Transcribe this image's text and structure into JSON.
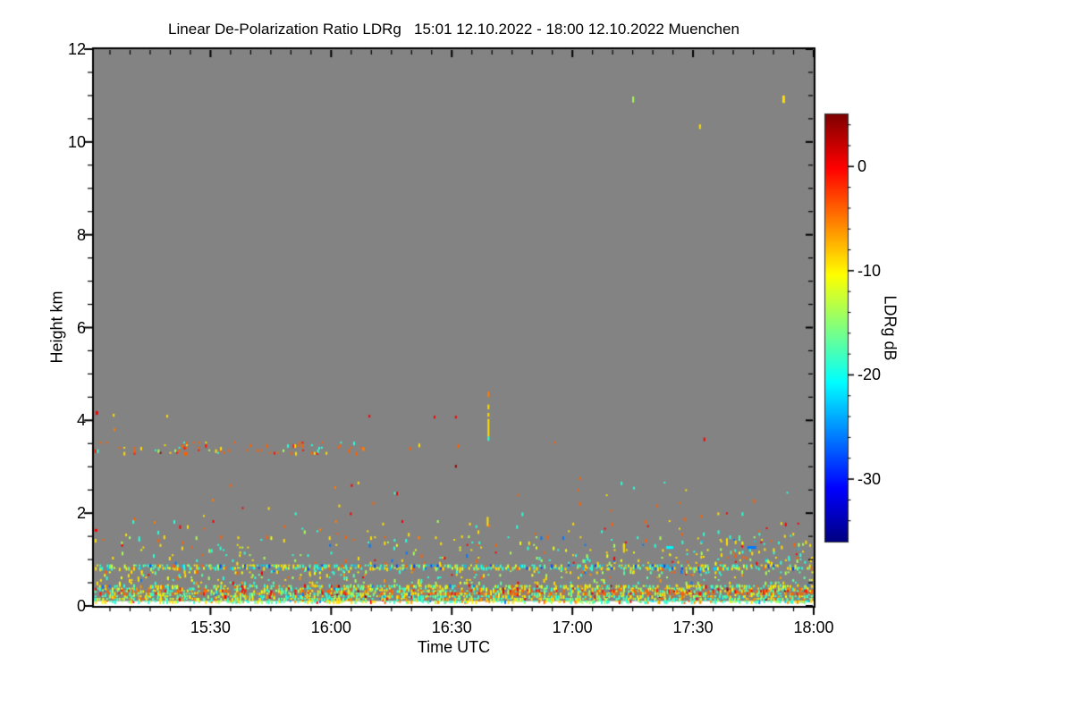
{
  "chart_data": {
    "type": "heatmap",
    "title": "Linear De-Polarization Ratio LDRg   15:01 12.10.2022 - 18:00 12.10.2022 Muenchen",
    "xlabel": "Time UTC",
    "ylabel": "Height km",
    "x_axis": {
      "start_label": "15:01",
      "end_label": "18:00",
      "duration_min": 179,
      "major_tick_minutes": [
        29,
        59,
        89,
        119,
        149,
        179
      ],
      "major_tick_labels": [
        "15:30",
        "16:00",
        "16:30",
        "17:00",
        "17:30",
        "18:00"
      ],
      "minor_tick_every_min": 5,
      "first_minor_min": 4
    },
    "y_axis": {
      "min": 0,
      "max": 12,
      "major_ticks": [
        0,
        2,
        4,
        6,
        8,
        10,
        12
      ],
      "minor_step": 0.5
    },
    "colorbar": {
      "label": "LDRg dB",
      "vmax": 5,
      "vmin": -36,
      "major_ticks": [
        0,
        -10,
        -20,
        -30
      ],
      "minor_step": 2,
      "colormap": "jet"
    },
    "colors": {
      "masked": "#838383",
      "below_ground": "#ffffff",
      "frame": "#000000",
      "text": "#000000"
    },
    "surface_top_km": 0.105,
    "noise_bands": [
      {
        "h": [
          0.1,
          0.45
        ],
        "density": 0.6,
        "palette": [
          [
            -19,
            0.2
          ],
          [
            -17,
            0.14
          ],
          [
            -14,
            0.12
          ],
          [
            -11,
            0.1
          ],
          [
            -9,
            0.22
          ],
          [
            -6,
            0.08
          ],
          [
            -4,
            0.07
          ],
          [
            0,
            0.04
          ],
          [
            -26,
            0.02
          ],
          [
            4,
            0.01
          ]
        ]
      },
      {
        "h": [
          0.1,
          0.22
        ],
        "density": 0.35,
        "palette": [
          [
            -19,
            0.25
          ],
          [
            -17,
            0.2
          ],
          [
            -14,
            0.15
          ],
          [
            -9,
            0.25
          ],
          [
            -6,
            0.1
          ],
          [
            -23,
            0.05
          ]
        ]
      },
      {
        "h": [
          0.28,
          0.38
        ],
        "density": 0.35,
        "palette": [
          [
            -4,
            0.45
          ],
          [
            -1,
            0.25
          ],
          [
            -9,
            0.18
          ],
          [
            -14,
            0.12
          ]
        ]
      },
      {
        "h": [
          0.45,
          0.75
        ],
        "density": 0.13,
        "palette": [
          [
            -19,
            0.2
          ],
          [
            -17,
            0.14
          ],
          [
            -14,
            0.12
          ],
          [
            -11,
            0.1
          ],
          [
            -9,
            0.22
          ],
          [
            -6,
            0.08
          ],
          [
            -4,
            0.07
          ],
          [
            0,
            0.05
          ],
          [
            -26,
            0.02
          ]
        ]
      },
      {
        "h": [
          0.75,
          0.82
        ],
        "density": 0.09,
        "palette": [
          [
            -19,
            0.25
          ],
          [
            -9,
            0.3
          ],
          [
            -14,
            0.2
          ],
          [
            -4,
            0.15
          ],
          [
            -26,
            0.1
          ]
        ]
      },
      {
        "h": [
          0.82,
          0.93
        ],
        "density": 0.62,
        "palette": [
          [
            -19,
            0.28
          ],
          [
            -17,
            0.12
          ],
          [
            -9,
            0.25
          ],
          [
            -12,
            0.15
          ],
          [
            -23,
            0.08
          ],
          [
            -4,
            0.06
          ],
          [
            -28,
            0.06
          ]
        ]
      },
      {
        "h": [
          0.93,
          1.5
        ],
        "density": 0.055,
        "palette": [
          [
            -19,
            0.22
          ],
          [
            -9,
            0.28
          ],
          [
            -14,
            0.14
          ],
          [
            -4,
            0.14
          ],
          [
            -11,
            0.1
          ],
          [
            0,
            0.06
          ],
          [
            -26,
            0.06
          ]
        ]
      },
      {
        "h": [
          0.95,
          1.4
        ],
        "t": [
          143,
          179
        ],
        "density": 0.08,
        "palette": [
          [
            -19,
            0.3
          ],
          [
            -9,
            0.3
          ],
          [
            -14,
            0.15
          ],
          [
            -4,
            0.1
          ],
          [
            -23,
            0.1
          ],
          [
            0,
            0.05
          ]
        ]
      },
      {
        "h": [
          1.4,
          1.8
        ],
        "t": [
          150,
          179
        ],
        "density": 0.025,
        "palette": [
          [
            -9,
            0.35
          ],
          [
            -4,
            0.25
          ],
          [
            -19,
            0.2
          ],
          [
            -14,
            0.1
          ],
          [
            0,
            0.1
          ]
        ]
      },
      {
        "h": [
          1.5,
          2.0
        ],
        "density": 0.02,
        "palette": [
          [
            -9,
            0.35
          ],
          [
            -4,
            0.25
          ],
          [
            -19,
            0.2
          ],
          [
            -14,
            0.1
          ],
          [
            0,
            0.1
          ]
        ]
      },
      {
        "h": [
          2.0,
          2.7
        ],
        "density": 0.006,
        "palette": [
          [
            -9,
            0.35
          ],
          [
            -4,
            0.3
          ],
          [
            -19,
            0.2
          ],
          [
            0,
            0.15
          ]
        ]
      },
      {
        "h": [
          2.7,
          3.25
        ],
        "density": 0.0015,
        "palette": [
          [
            -4,
            0.5
          ],
          [
            -9,
            0.3
          ],
          [
            0,
            0.2
          ]
        ]
      },
      {
        "h": [
          3.3,
          3.56
        ],
        "t": [
          0,
          68
        ],
        "density": 0.13,
        "palette": [
          [
            -4,
            0.5
          ],
          [
            -1,
            0.12
          ],
          [
            -9,
            0.14
          ],
          [
            4,
            0.04
          ],
          [
            -14,
            0.1
          ],
          [
            -19,
            0.1
          ]
        ]
      },
      {
        "h": [
          3.3,
          3.56
        ],
        "t": [
          68,
          125
        ],
        "density": 0.012,
        "palette": [
          [
            -4,
            0.55
          ],
          [
            -1,
            0.15
          ],
          [
            -9,
            0.2
          ],
          [
            -19,
            0.1
          ]
        ]
      }
    ],
    "segments": [
      [
        97.9,
        4.62,
        4.5,
        -5,
        2
      ],
      [
        97.9,
        4.34,
        4.24,
        -9,
        2
      ],
      [
        97.9,
        4.16,
        4.08,
        -9,
        2
      ],
      [
        97.9,
        4.03,
        3.65,
        -9,
        2
      ],
      [
        97.9,
        3.65,
        3.56,
        -19,
        2
      ],
      [
        97.7,
        1.92,
        1.72,
        -9,
        2
      ],
      [
        98.1,
        1.76,
        1.7,
        -5,
        2
      ],
      [
        133.9,
        10.98,
        10.85,
        -14,
        2
      ],
      [
        171.2,
        11.0,
        10.84,
        -9,
        3
      ],
      [
        150.5,
        10.38,
        10.28,
        -9,
        2
      ],
      [
        68.3,
        4.12,
        4.06,
        0,
        2
      ],
      [
        84.5,
        4.1,
        4.04,
        0,
        2
      ],
      [
        89.8,
        4.1,
        4.04,
        0,
        2
      ],
      [
        0.4,
        4.2,
        4.12,
        0,
        3
      ],
      [
        4.7,
        4.14,
        4.08,
        -9,
        2
      ],
      [
        18.0,
        4.12,
        4.06,
        -9,
        2
      ],
      [
        4.9,
        3.83,
        3.77,
        -5,
        2
      ],
      [
        80.7,
        3.5,
        3.42,
        -9,
        2
      ],
      [
        66.7,
        3.42,
        3.34,
        -5,
        3
      ],
      [
        151.6,
        3.63,
        3.55,
        0,
        2
      ],
      [
        89.8,
        3.04,
        2.98,
        4,
        2
      ],
      [
        59.8,
        2.58,
        2.52,
        -5,
        2
      ],
      [
        29.4,
        2.31,
        2.25,
        -5,
        2
      ],
      [
        76.5,
        1.85,
        1.79,
        0,
        2
      ],
      [
        80.5,
        1.5,
        1.44,
        -5,
        3
      ],
      [
        86.1,
        1.37,
        1.31,
        -9,
        2
      ],
      [
        9.6,
        1.85,
        1.77,
        -19,
        2
      ],
      [
        14.9,
        1.83,
        1.77,
        -5,
        2
      ],
      [
        19.8,
        1.85,
        1.77,
        -19,
        2
      ],
      [
        15.8,
        1.62,
        1.54,
        -19,
        2
      ],
      [
        7.8,
        1.56,
        1.5,
        -9,
        2
      ],
      [
        17.3,
        1.52,
        1.44,
        -9,
        2
      ],
      [
        60.0,
        1.85,
        1.79,
        -5,
        2
      ],
      [
        56.0,
        1.67,
        1.61,
        -5,
        2
      ],
      [
        0.2,
        1.66,
        1.6,
        0,
        3
      ],
      [
        142.3,
        1.29,
        1.23,
        -21,
        8
      ],
      [
        162.5,
        1.29,
        1.23,
        -26,
        10
      ],
      [
        131.6,
        1.35,
        1.15,
        -9,
        2
      ],
      [
        157.2,
        1.46,
        1.3,
        -9,
        2
      ],
      [
        160.3,
        1.52,
        1.4,
        -17,
        2
      ]
    ]
  }
}
